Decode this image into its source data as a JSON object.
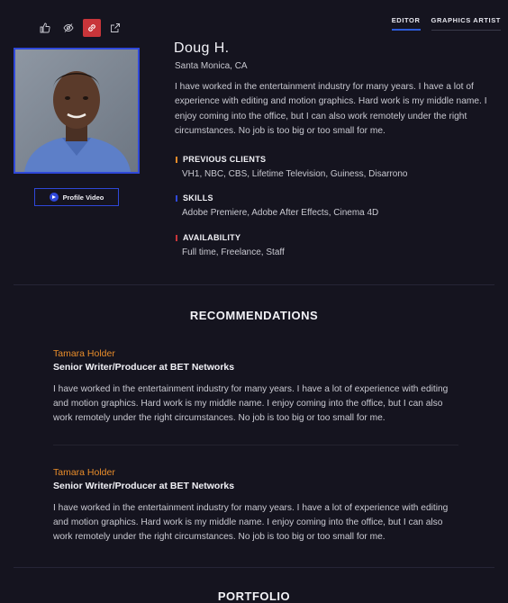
{
  "toolbar": {
    "icons": [
      "thumbs-up-icon",
      "hide-icon",
      "link-icon",
      "external-link-icon"
    ],
    "active_icon": "link-icon"
  },
  "tabs": [
    {
      "label": "EDITOR",
      "active": true
    },
    {
      "label": "GRAPHICS ARTIST",
      "active": false
    }
  ],
  "profile": {
    "name": "Doug H.",
    "location": "Santa Monica, CA",
    "bio": "I have worked in the entertainment industry for many years. I have a lot of experience with editing and motion graphics. Hard work is my middle name. I enjoy coming into the office, but I can also work remotely under the right circumstances. No job is too big or too small for me.",
    "video_button": "Profile Video"
  },
  "sections": [
    {
      "title": "PREVIOUS CLIENTS",
      "body": "VH1, NBC, CBS, Lifetime Television, Guiness, Disarrono",
      "color": "#e88c2a"
    },
    {
      "title": "SKILLS",
      "body": "Adobe Premiere, Adobe After Effects, Cinema 4D",
      "color": "#2f48d9"
    },
    {
      "title": "AVAILABILITY",
      "body": "Full time, Freelance, Staff",
      "color": "#c8353a"
    }
  ],
  "recommendations": {
    "heading": "RECOMMENDATIONS",
    "items": [
      {
        "name": "Tamara Holder",
        "role": "Senior Writer/Producer at BET Networks",
        "text": "I have worked in the entertainment industry for many years. I have a lot of experience with editing and motion graphics. Hard work is my middle name. I enjoy coming into the office, but I can also work remotely under the right circumstances. No job is too big or too small for me."
      },
      {
        "name": "Tamara Holder",
        "role": "Senior Writer/Producer at BET Networks",
        "text": "I have worked in the entertainment industry for many years. I have a lot of experience with editing and motion graphics. Hard work is my middle name. I enjoy coming into the office, but I can also work remotely under the right circumstances. No job is too big or too small for me."
      }
    ]
  },
  "portfolio": {
    "heading": "PORTFOLIO"
  },
  "colors": {
    "background": "#15141f",
    "accent_blue": "#2f48d9",
    "accent_red": "#c8353a",
    "accent_orange": "#e88c2a"
  }
}
